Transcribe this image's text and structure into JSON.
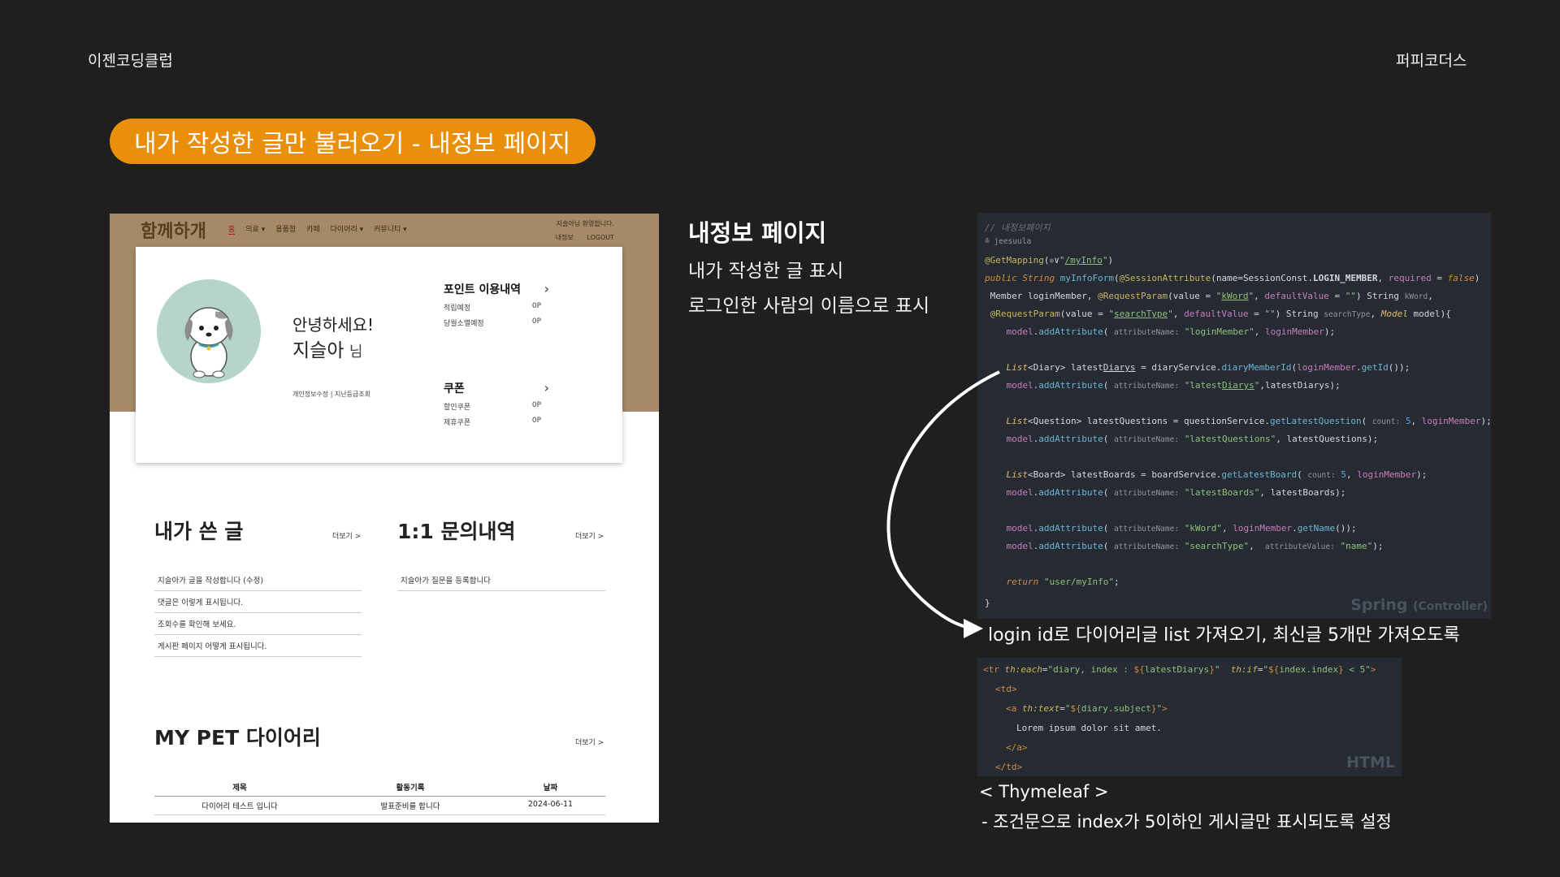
{
  "slide": {
    "club": "이젠코딩클럽",
    "team": "퍼피코더스",
    "title": "내가 작성한 글만 불러오기 - 내정보 페이지"
  },
  "site": {
    "logo": "함께하개",
    "nav": [
      "홈",
      "의료 ▾",
      "용품점",
      "카페",
      "다이어리 ▾",
      "커뮤니티 ▾"
    ],
    "greeting": "지슬아님 환영합니다.",
    "top_links": [
      "내정보",
      "LOGOUT"
    ],
    "hello": "안녕하세요!",
    "user_name": "지슬아",
    "user_suffix": "님",
    "profile_links": "개인정보수정 | 지난등급조회",
    "points": {
      "title": "포인트 이용내역",
      "rows": [
        {
          "label": "적립예정",
          "value": "0P"
        },
        {
          "label": "당월소멸예정",
          "value": "0P"
        }
      ]
    },
    "coupons": {
      "title": "쿠폰",
      "rows": [
        {
          "label": "할인쿠폰",
          "value": "0P"
        },
        {
          "label": "제휴쿠폰",
          "value": "0P"
        }
      ]
    },
    "my_posts": {
      "title": "내가 쓴 글",
      "more": "더보기 >",
      "items": [
        "지슬아가 글을 작성합니다 (수정)",
        "댓글은 이렇게 표시됩니다.",
        "조회수를 확인해 보세요.",
        "게시판 페이지 어떻게 표시됩니다."
      ]
    },
    "inquiries": {
      "title": "1:1 문의내역",
      "more": "더보기 >",
      "items": [
        "지슬아가 질문을 등록합니다"
      ]
    },
    "diary": {
      "title": "MY PET 다이어리",
      "more": "더보기 >",
      "columns": [
        "제목",
        "활동기록",
        "날짜"
      ],
      "rows": [
        [
          "다이어리 테스트 입니다",
          "발표준비를 합니다",
          "2024-06-11"
        ]
      ]
    }
  },
  "desc": {
    "title": "내정보 페이지",
    "lines": [
      "내가 작성한 글 표시",
      "로그인한 사람의 이름으로 표시"
    ]
  },
  "code_controller": {
    "comment": "// 내정보페이지",
    "author": "jeesuula",
    "watermark": "Spring",
    "watermark_sub": "(Controller)"
  },
  "arrow_note": "login id로 다이어리글 list 가져오기, 최신글 5개만 가져오도록",
  "code_html": {
    "watermark": "HTML",
    "lorem": "Lorem ipsum dolor sit amet."
  },
  "thymeleaf": {
    "title": "< Thymeleaf >",
    "desc": "- 조건문으로 index가 5이하인 게시글만 표시되도록 설정"
  },
  "colors": {
    "accent": "#e98f0b",
    "background": "#1f1f1f",
    "site_band": "#a48a66"
  }
}
